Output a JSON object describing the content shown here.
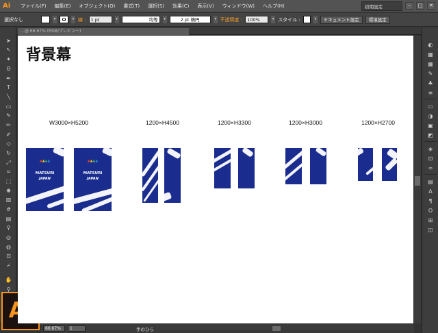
{
  "app": {
    "logo_text": "Ai",
    "big_logo_text": "Ai"
  },
  "menu": [
    "ファイル(F)",
    "編集(E)",
    "オブジェクト(O)",
    "書式(T)",
    "選択(S)",
    "効果(C)",
    "表示(V)",
    "ウィンドウ(W)",
    "ヘルプ(H)"
  ],
  "workspace": {
    "value": "初期設定"
  },
  "window_controls": [
    "–",
    "□",
    "✕"
  ],
  "control_bar": {
    "selection": "選択なし",
    "stroke_label": "線 :",
    "stroke_value": "1 pt",
    "profile_label": "均等",
    "brush_label": "2 pt 楕円",
    "opacity_label": "不透明度 :",
    "opacity_value": "100%",
    "style_label": "スタイル :",
    "doc_setup_button": "ドキュメント設定",
    "prefs_button": "環境設定"
  },
  "document_tab": {
    "title": "…@ 66.67% (RGB/プレビュー)"
  },
  "canvas": {
    "heading": "背景幕",
    "sizes": [
      "W3000×H5200",
      "1200×H4500",
      "1200×H3300",
      "1200×H3000",
      "1200×H2700"
    ],
    "panel_logo_text": "MATSURI",
    "panel_logo_sub": "JAPAN"
  },
  "status": {
    "zoom": "66.67%",
    "page": "1",
    "tool_text": "手のひら"
  },
  "colors": {
    "accent": "#f7941d",
    "panel_blue": "#1a2d8e",
    "ui_dark": "#3d3d3d"
  },
  "tool_icons": [
    "selection-arrow-icon",
    "direct-select-icon",
    "magic-wand-icon",
    "lasso-icon",
    "pen-icon",
    "type-icon",
    "line-icon",
    "rectangle-icon",
    "paintbrush-icon",
    "pencil-icon",
    "blob-brush-icon",
    "eraser-icon",
    "rotate-icon",
    "scale-icon",
    "warp-icon",
    "free-transform-icon",
    "symbol-sprayer-icon",
    "graph-icon",
    "mesh-icon",
    "gradient-icon",
    "eyedropper-icon",
    "blend-icon",
    "live-paint-icon",
    "artboard-icon",
    "slice-icon",
    "hand-icon",
    "zoom-icon"
  ],
  "panel_icons": [
    "color-icon",
    "color-guide-icon",
    "swatches-icon",
    "brushes-icon",
    "symbols-icon",
    "stroke-icon",
    "gradient-panel-icon",
    "transparency-icon",
    "appearance-icon",
    "graphic-styles-icon",
    "layers-icon",
    "artboards-icon",
    "links-icon",
    "align-icon",
    "character-icon",
    "paragraph-icon",
    "opentype-icon",
    "transform-icon",
    "pathfinder-icon"
  ]
}
